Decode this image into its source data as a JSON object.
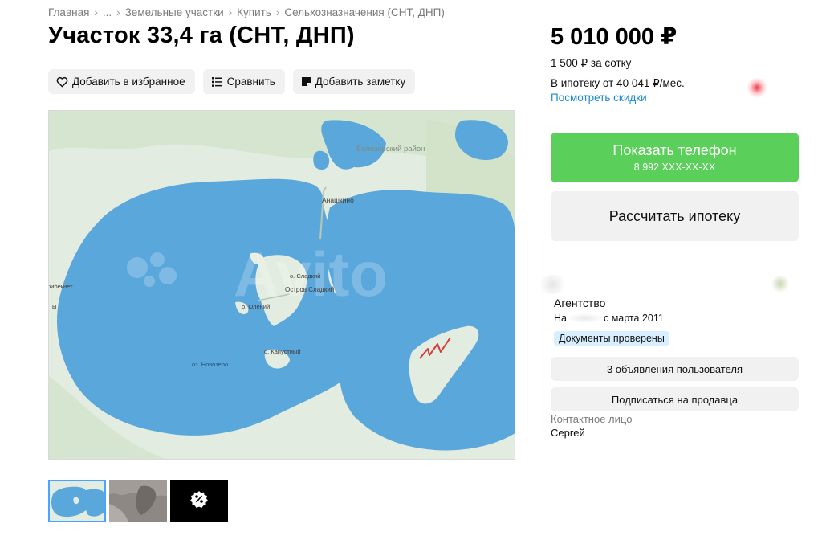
{
  "breadcrumbs": [
    "Главная",
    "...",
    "Земельные участки",
    "Купить",
    "Сельхозназначения (СНТ, ДНП)"
  ],
  "title": "Участок 33,4 га (СНТ, ДНП)",
  "actions": {
    "favorite": "Добавить в избранное",
    "compare": "Сравнить",
    "note": "Добавить заметку"
  },
  "map": {
    "labels": {
      "district": "Белозерский район",
      "village": "Анашкино",
      "island_sladkiy": "о. Сладкий",
      "island_sladkiy_main": "Остров Сладкий",
      "island_olenyi": "о. Олений",
      "island_kapustny": "о. Капустный",
      "lake_novozero": "оз. Новозеро",
      "left_edge_1": "рибекнет",
      "left_edge_2": "ы"
    },
    "watermark": "Avito",
    "colors": {
      "water": "#5aa7dc",
      "land": "#e3ece0",
      "marker": "#d23c3c"
    }
  },
  "thumbnails": [
    "map-thumb",
    "plot-photo-thumb",
    "more-photos-thumb"
  ],
  "price": {
    "value": "5 010 000 ₽",
    "per_unit": "1 500 ₽ за сотку",
    "mortgage": "В ипотеку от 40 041 ₽/мес.",
    "discounts_link": "Посмотреть скидки"
  },
  "phone_button": {
    "label": "Показать телефон",
    "number": "8 992 XXX-XX-XX",
    "color": "#5ad05a"
  },
  "mortgage_button": "Рассчитать ипотеку",
  "seller": {
    "type": "Агентство",
    "since_prefix": "На",
    "since_suffix": "с марта 2011",
    "badge": "Документы проверены",
    "listings_button": "3 объявления пользователя",
    "subscribe_button": "Подписаться на продавца",
    "contact_label": "Контактное лицо",
    "contact_name": "Сергей"
  },
  "colors": {
    "link": "#1c8ad6",
    "badge_bg": "#d8efff",
    "button_bg": "#f1f1f1"
  }
}
